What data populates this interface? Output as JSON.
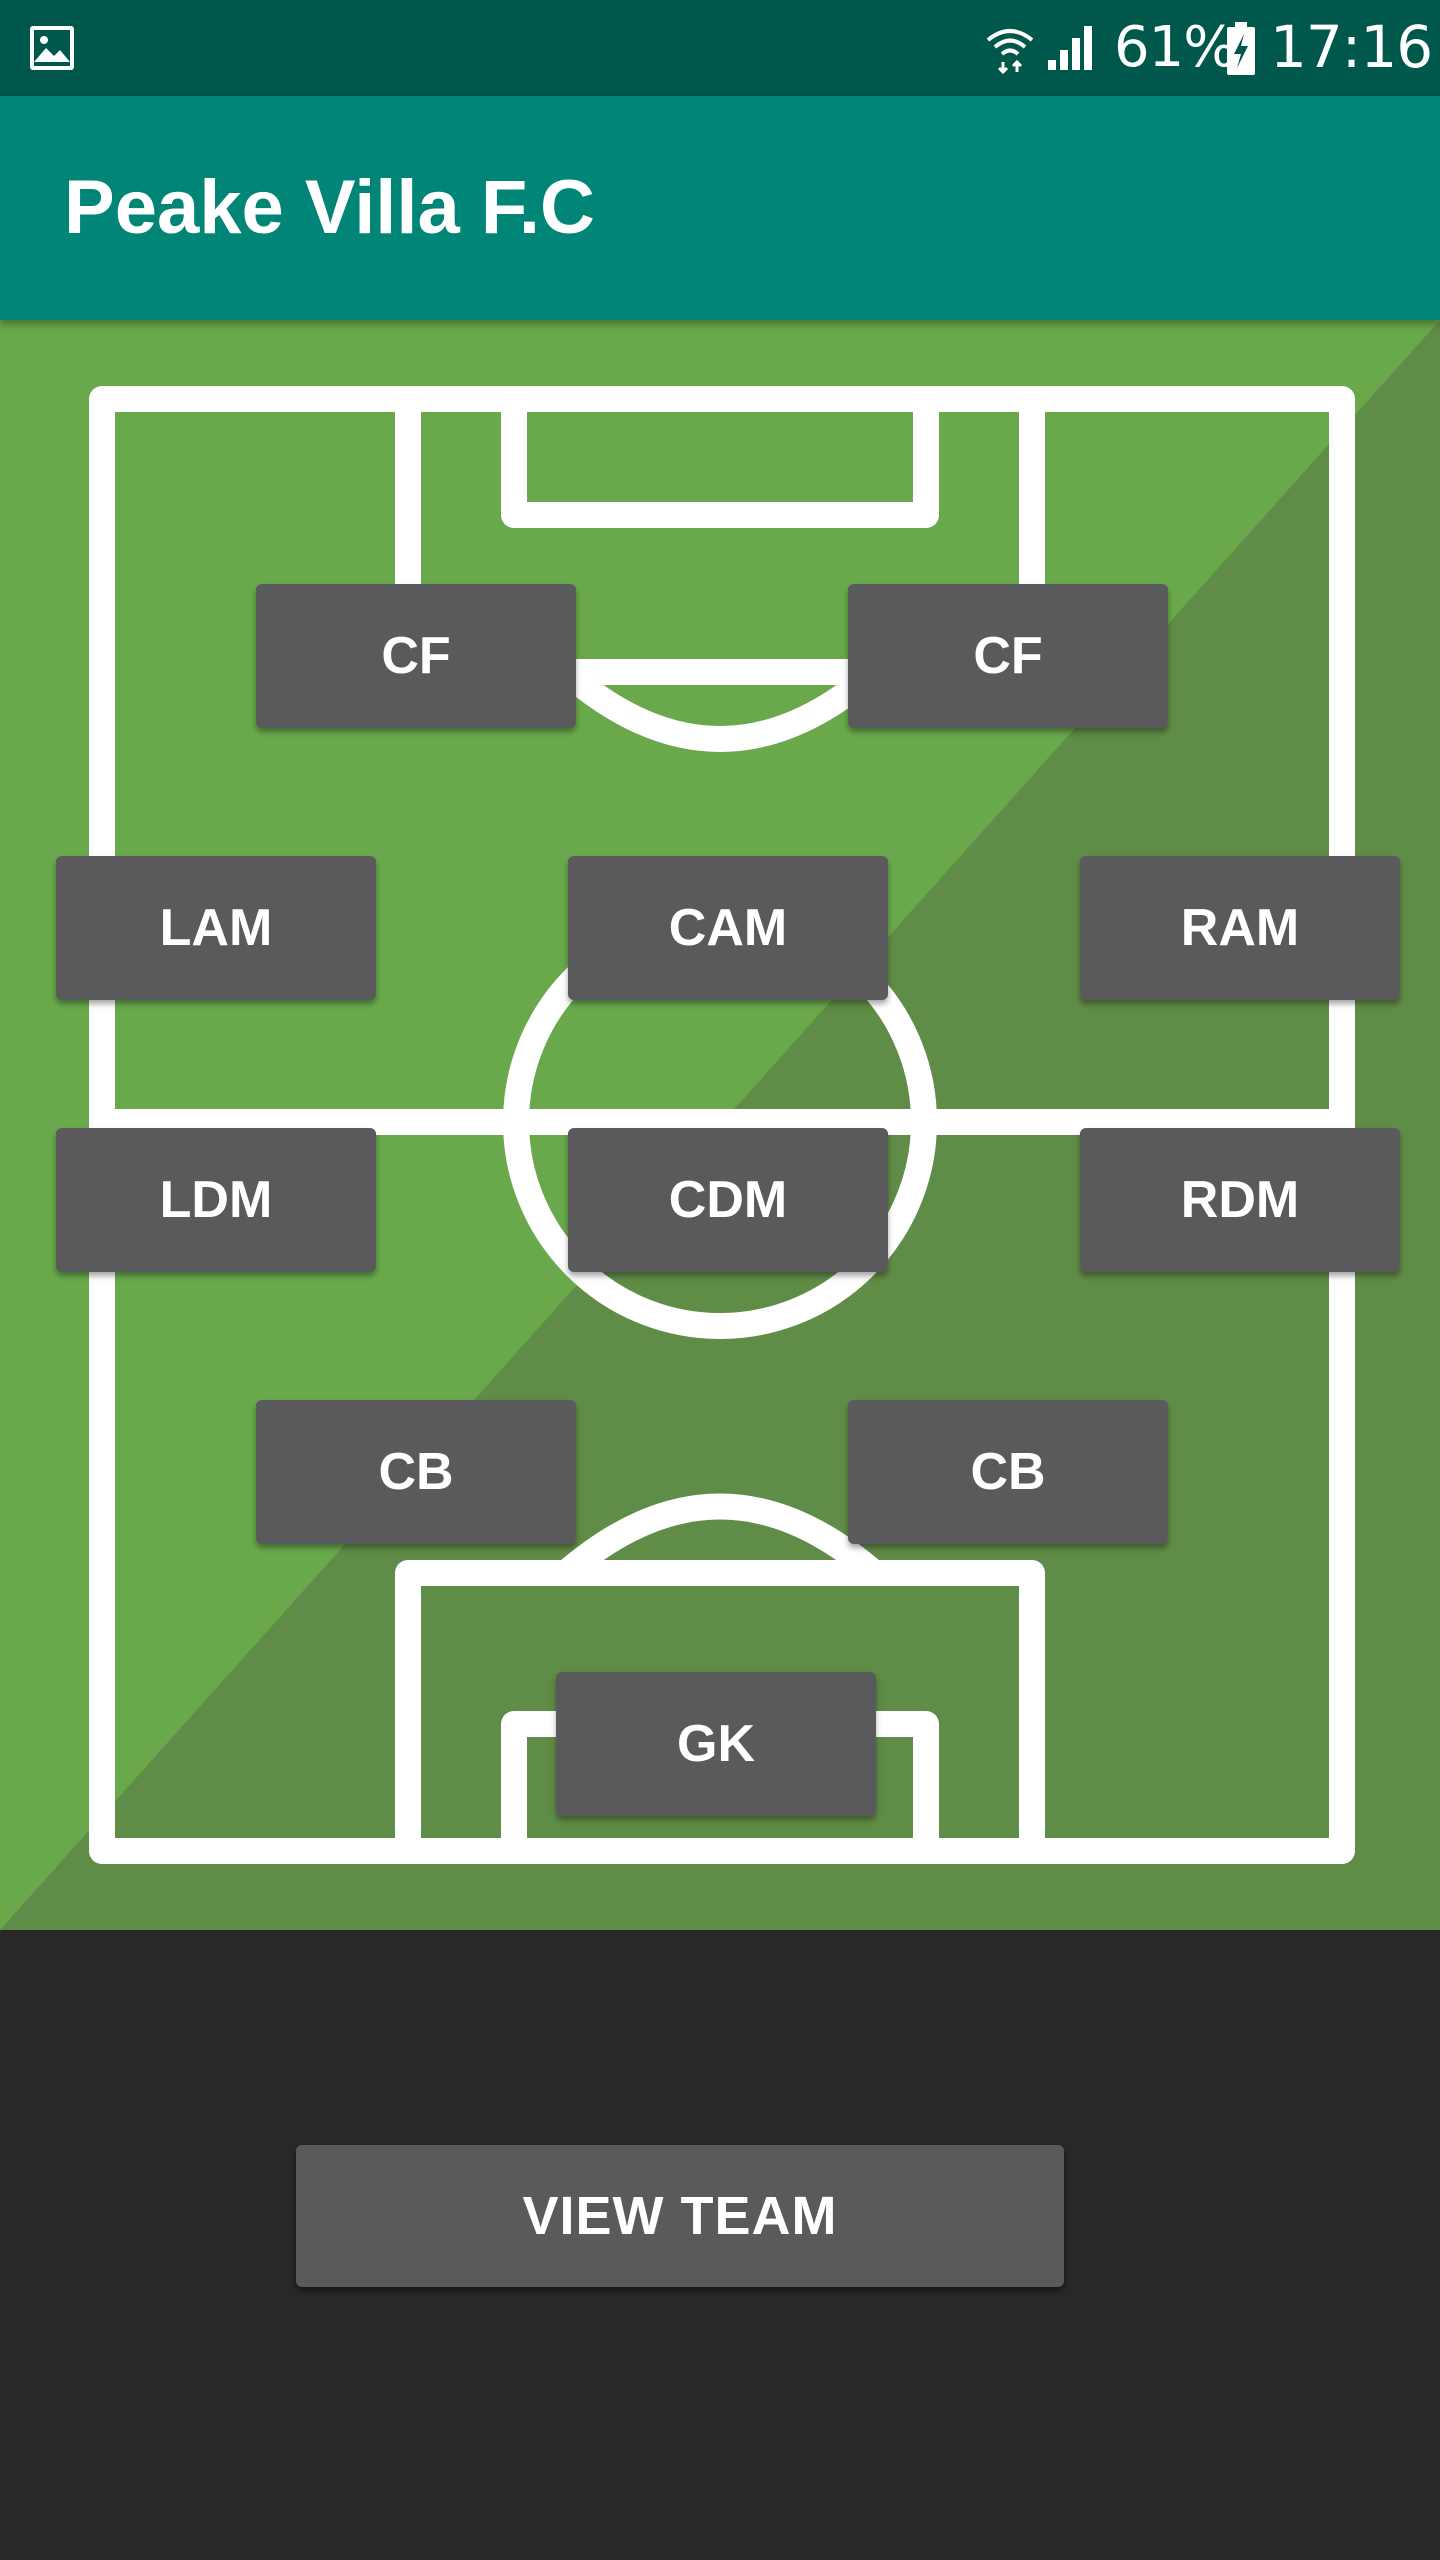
{
  "status_bar": {
    "battery_percent": "61%",
    "time": "17:16",
    "icons": [
      "gallery-icon",
      "wifi-icon",
      "signal-icon",
      "battery-charging-icon"
    ]
  },
  "app_bar": {
    "title": "Peake Villa F.C"
  },
  "pitch": {
    "colors": {
      "grass_light": "#69a94b",
      "grass_dark": "#5f8c47",
      "lines": "#ffffff"
    },
    "positions": {
      "cf_left": "CF",
      "cf_right": "CF",
      "lam": "LAM",
      "cam": "CAM",
      "ram": "RAM",
      "ldm": "LDM",
      "cdm": "CDM",
      "rdm": "RDM",
      "cb_left": "CB",
      "cb_right": "CB",
      "gk": "GK"
    }
  },
  "actions": {
    "view_team_label": "VIEW TEAM"
  },
  "theme": {
    "status_bar_color": "#00574b",
    "app_bar_color": "#008577",
    "background": "#282828",
    "button_color": "#5a5a5c"
  }
}
